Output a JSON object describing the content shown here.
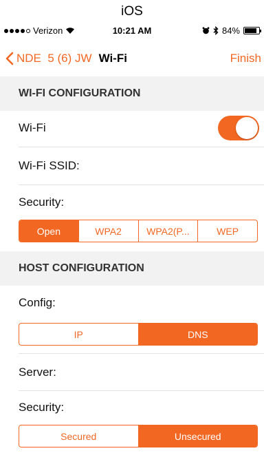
{
  "os_label": "iOS",
  "status_bar": {
    "carrier": "Verizon",
    "time": "10:21 AM",
    "battery_percent": "84%",
    "battery_level": 0.84
  },
  "nav": {
    "back_label": "NDE  5 (6) JW",
    "title": "Wi-Fi",
    "finish_label": "Finish",
    "accent_color": "#f26722"
  },
  "wifi_section": {
    "header": "WI-FI CONFIGURATION",
    "wifi_label": "Wi-Fi",
    "wifi_enabled": true,
    "ssid_label": "Wi-Fi SSID:",
    "security_label": "Security:",
    "security_options": [
      "Open",
      "WPA2",
      "WPA2(P...",
      "WEP"
    ],
    "security_selected": "Open"
  },
  "host_section": {
    "header": "HOST CONFIGURATION",
    "config_label": "Config:",
    "config_options": [
      "IP",
      "DNS"
    ],
    "config_selected": "DNS",
    "server_label": "Server:",
    "security_label": "Security:",
    "security_options": [
      "Secured",
      "Unsecured"
    ],
    "security_selected": "Unsecured"
  }
}
